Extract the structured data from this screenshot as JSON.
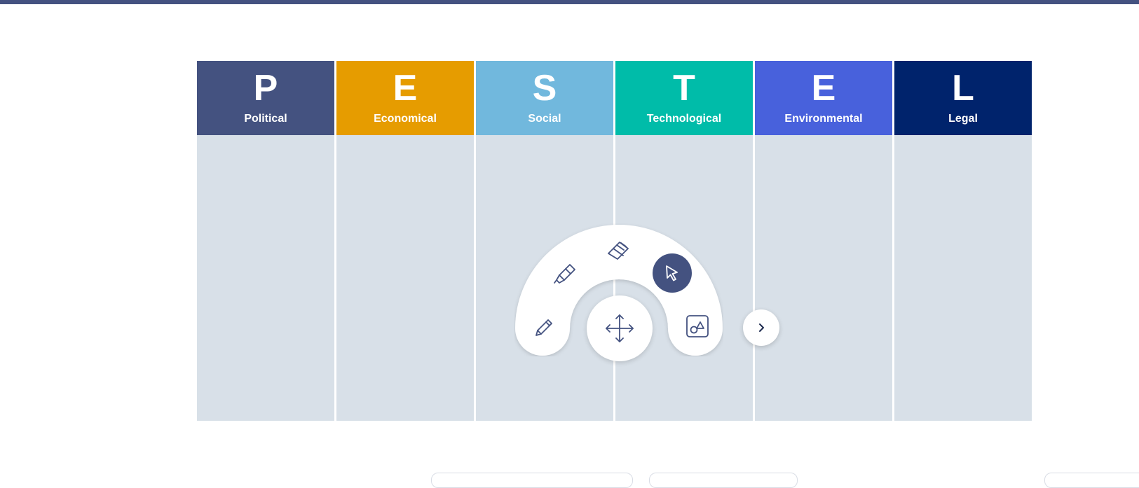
{
  "colors": {
    "topbar": "#445280",
    "column_body": "#d8e0e8",
    "tool_icon": "#445280",
    "active_tool": "#445280"
  },
  "pestel": {
    "columns": [
      {
        "letter": "P",
        "label": "Political",
        "color": "#445280"
      },
      {
        "letter": "E",
        "label": "Economical",
        "color": "#e69c00"
      },
      {
        "letter": "S",
        "label": "Social",
        "color": "#71b8dd"
      },
      {
        "letter": "T",
        "label": "Technological",
        "color": "#00bca9"
      },
      {
        "letter": "E",
        "label": "Environmental",
        "color": "#4861dc"
      },
      {
        "letter": "L",
        "label": "Legal",
        "color": "#00236c"
      }
    ]
  },
  "toolbar": {
    "tools": [
      {
        "icon": "pencil-icon",
        "active": false
      },
      {
        "icon": "highlighter-icon",
        "active": false
      },
      {
        "icon": "eraser-icon",
        "active": false
      },
      {
        "icon": "cursor-arrow-icon",
        "active": true
      },
      {
        "icon": "shapes-icon",
        "active": false
      }
    ],
    "move_icon": "move-arrows-icon",
    "expand_icon": "chevron-right-icon"
  }
}
